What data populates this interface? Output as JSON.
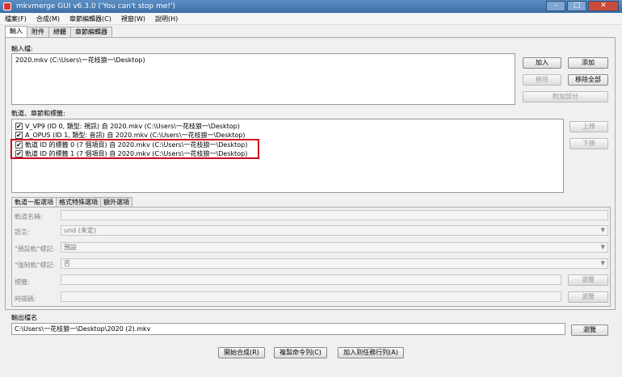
{
  "window": {
    "title": "mkvmerge GUI v6.3.0 ('You can't stop me!')"
  },
  "menu": [
    "檔案(F)",
    "合成(M)",
    "章節編輯器(C)",
    "視窗(W)",
    "說明(H)"
  ],
  "tabs": [
    "輸入",
    "附件",
    "總體",
    "章節編輯器"
  ],
  "input": {
    "files_label": "輸入檔:",
    "files": [
      "2020.mkv (C:\\Users\\一花枝狼一\\Desktop)"
    ],
    "add_btn": "加入",
    "append_btn": "添加",
    "remove_btn": "移除",
    "remove_all_btn": "移除全部",
    "additional_btn": "附加部分"
  },
  "tracks": {
    "label": "軌道、章節和標籤:",
    "items": [
      {
        "text": "V_VP9 (ID 0, 類型: 視訊) 自 2020.mkv (C:\\Users\\一花枝狼一\\Desktop)",
        "checked": true
      },
      {
        "text": "A_OPUS (ID 1, 類型: 音訊) 自 2020.mkv (C:\\Users\\一花枝狼一\\Desktop)",
        "checked": true
      },
      {
        "text": "軌道 ID 的標籤 0 (7 個項目) 自 2020.mkv (C:\\Users\\一花枝狼一\\Desktop)",
        "checked": true
      },
      {
        "text": "軌道 ID 的標籤 1 (7 個項目) 自 2020.mkv (C:\\Users\\一花枝狼一\\Desktop)",
        "checked": true
      }
    ],
    "up_btn": "上移",
    "down_btn": "下移"
  },
  "subtabs": [
    "軌道一般選項",
    "格式特殊選項",
    "額外選項"
  ],
  "options": {
    "track_name_label": "軌道名稱:",
    "language_label": "語言:",
    "language_value": "und (未定)",
    "default_label": "\"預設軌\"標記:",
    "default_value": "預設",
    "forced_label": "\"強制軌\"標記:",
    "forced_value": "否",
    "tags_label": "標籤:",
    "browse1": "瀏覽",
    "timecodes_label": "時間碼:",
    "browse2": "瀏覽"
  },
  "output": {
    "label": "輸出檔名",
    "value": "C:\\Users\\一花枝狼一\\Desktop\\2020 (2).mkv",
    "browse_btn": "瀏覽"
  },
  "actions": {
    "start_btn": "開始合成(R)",
    "copy_btn": "複製命令列(C)",
    "queue_btn": "加入到任務行列(A)"
  },
  "colors": {
    "highlight": "#d0021b",
    "titlebar": "#4a7db5"
  }
}
